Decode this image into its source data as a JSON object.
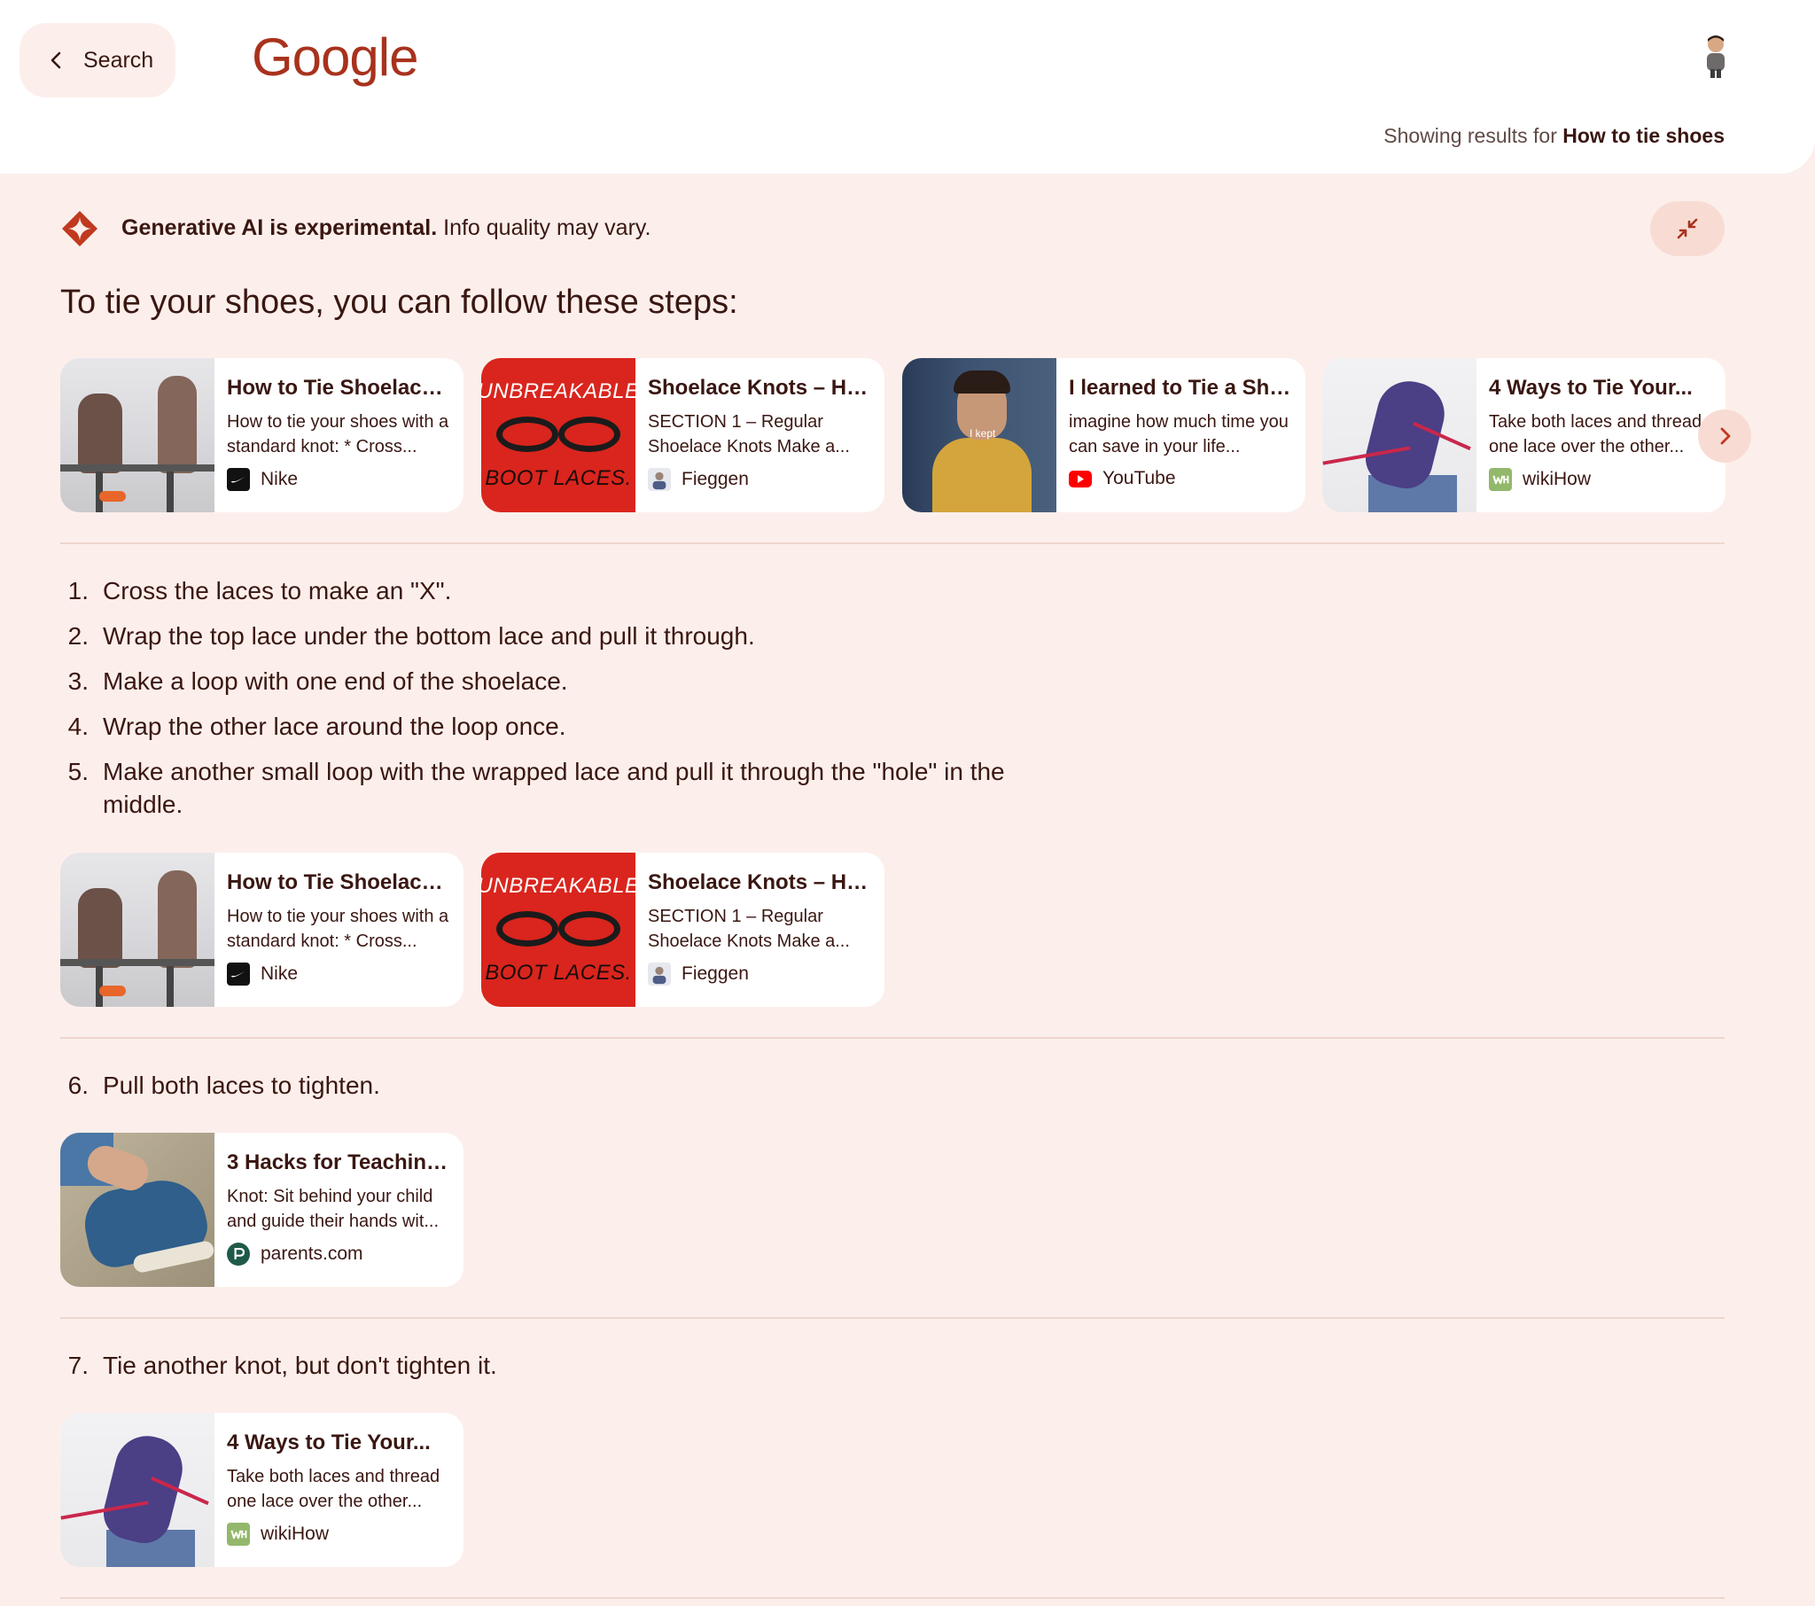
{
  "header": {
    "back_label": "Search",
    "logo": "Google",
    "showing_prefix": "Showing results for",
    "showing_query": "How to tie shoes"
  },
  "ai_banner": {
    "bold": "Generative AI is experimental.",
    "rest": " Info quality may vary."
  },
  "headline": "To tie your shoes, you can follow these steps:",
  "thumb_text": {
    "laces_top": "UNBREAKABLE",
    "laces_bottom": "BOOT LACES.",
    "youtube_caption": "I kept"
  },
  "cards": {
    "nike": {
      "title": "How to Tie Shoelaces...",
      "snippet": "How to tie your shoes with a standard knot: * Cross...",
      "source": "Nike"
    },
    "fieggen": {
      "title": "Shoelace Knots – Ho...",
      "snippet": "SECTION 1 – Regular Shoelace Knots Make a...",
      "source": "Fieggen"
    },
    "youtube": {
      "title": "I learned to Tie a Sho...",
      "snippet": "imagine how much time you can save in your life...",
      "source": "YouTube"
    },
    "wikihow": {
      "title": "4 Ways to Tie Your...",
      "snippet": "Take both laces and thread one lace over the other...",
      "source": "wikiHow"
    },
    "parents": {
      "title": "3 Hacks for Teaching...",
      "snippet": "Knot: Sit behind your child and guide their hands wit...",
      "source": "parents.com"
    }
  },
  "steps": [
    {
      "num": "1.",
      "text": "Cross the laces to make an \"X\"."
    },
    {
      "num": "2.",
      "text": "Wrap the top lace under the bottom lace and pull it through."
    },
    {
      "num": "3.",
      "text": "Make a loop with one end of the shoelace."
    },
    {
      "num": "4.",
      "text": "Wrap the other lace around the loop once."
    },
    {
      "num": "5.",
      "text": "Make another small loop with the wrapped lace and pull it through the \"hole\" in the middle."
    },
    {
      "num": "6.",
      "text": "Pull both laces to tighten."
    },
    {
      "num": "7.",
      "text": "Tie another knot, but don't tighten it."
    }
  ],
  "colors": {
    "background": "#fcefeb",
    "accent": "#a8321d",
    "text": "#3a1712"
  }
}
